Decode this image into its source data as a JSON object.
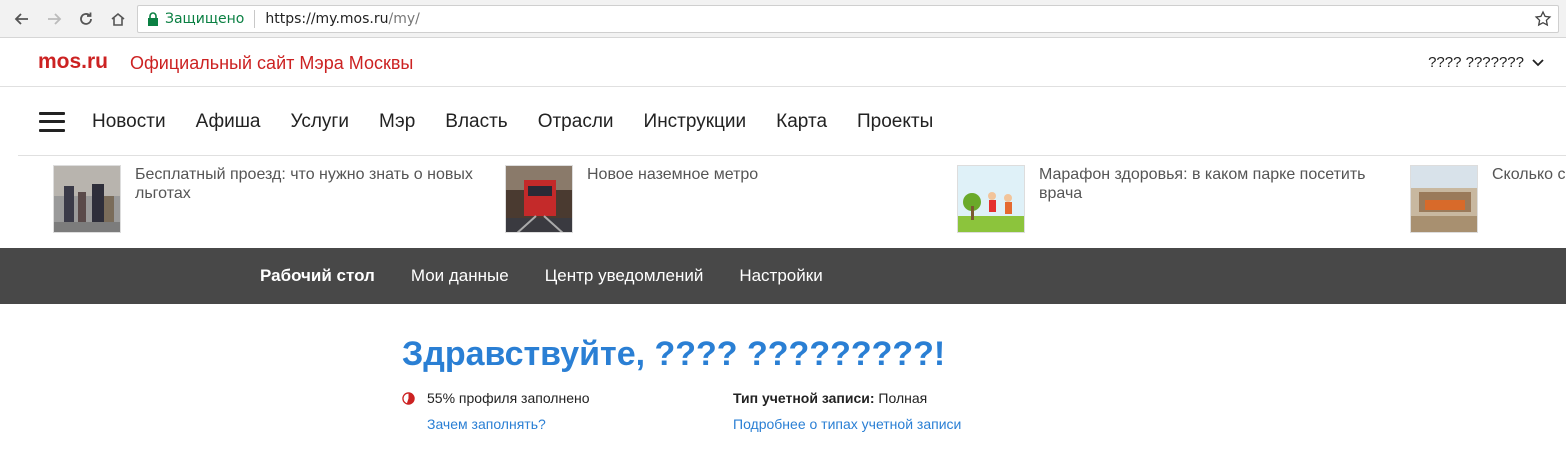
{
  "browser": {
    "secure_label": "Защищено",
    "url_host": "https://my.mos.ru",
    "url_path": "/my/"
  },
  "site": {
    "logo": "mos.ru",
    "title": "Официальный сайт Мэра Москвы",
    "user_name": "???? ???????"
  },
  "nav": {
    "items": [
      "Новости",
      "Афиша",
      "Услуги",
      "Мэр",
      "Власть",
      "Отрасли",
      "Инструкции",
      "Карта",
      "Проекты"
    ]
  },
  "news": [
    {
      "text": "Бесплатный проезд: что нужно знать о новых льготах"
    },
    {
      "text": "Новое наземное метро"
    },
    {
      "text": "Марафон здоровья: в каком парке посетить врача"
    },
    {
      "text": "Сколько с"
    }
  ],
  "account_nav": {
    "items": [
      "Рабочий стол",
      "Мои данные",
      "Центр уведомлений",
      "Настройки"
    ],
    "active": "Рабочий стол"
  },
  "dashboard": {
    "greeting": "Здравствуйте, ???? ?????????!",
    "profile_fill_text": "55% профиля заполнено",
    "profile_fill_percent": 55,
    "why_link": "Зачем заполнять?",
    "account_type_label": "Тип учетной записи:",
    "account_type_value": "Полная",
    "account_type_link": "Подробнее о типах учетной записи"
  },
  "colors": {
    "brand_red": "#cc2222",
    "link_blue": "#2a7fd4",
    "account_bar": "#484848",
    "secure_green": "#0b8043"
  }
}
